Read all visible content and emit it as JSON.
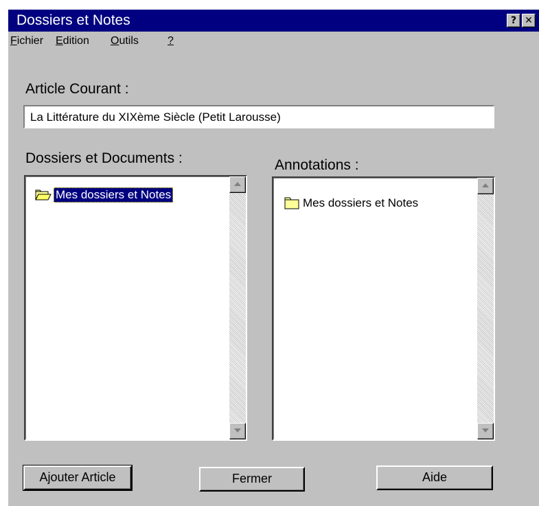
{
  "window": {
    "title": "Dossiers et Notes",
    "help_glyph": "?",
    "close_glyph": "✕",
    "titlebar_color": "#000080",
    "face_color": "#c0c0c0"
  },
  "menu": {
    "items": [
      {
        "underlined": "F",
        "rest": "ichier"
      },
      {
        "underlined": "E",
        "rest": "dition"
      },
      {
        "underlined": "O",
        "rest": "utils"
      },
      {
        "underlined": "?",
        "rest": ""
      }
    ]
  },
  "article": {
    "label": "Article Courant :",
    "value": "La Littérature du XIXème Siècle (Petit Larousse)"
  },
  "folders_panel": {
    "label": "Dossiers et Documents :",
    "items": [
      {
        "label": "Mes dossiers et Notes",
        "icon": "open-folder-icon",
        "selected": true
      }
    ]
  },
  "annotations_panel": {
    "label": "Annotations :",
    "items": [
      {
        "label": "Mes dossiers et Notes",
        "icon": "folder-icon",
        "selected": false
      }
    ]
  },
  "buttons": {
    "add_article": "Ajouter Article",
    "close": "Fermer",
    "help": "Aide"
  },
  "colors": {
    "selection": "#000080",
    "folder_fill": "#ffff99"
  }
}
